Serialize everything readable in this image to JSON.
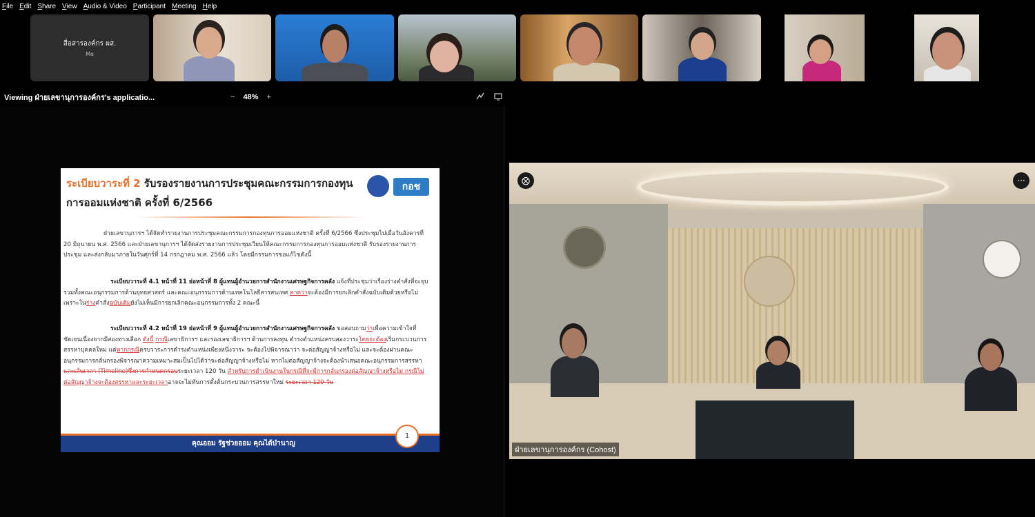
{
  "menu": [
    "File",
    "Edit",
    "Share",
    "View",
    "Audio & Video",
    "Participant",
    "Meeting",
    "Help"
  ],
  "participants": {
    "me_name": "สื่อสารองค์กร ผส.",
    "me_tag": "Me"
  },
  "viewbar": {
    "viewing": "Viewing ฝ่ายเลขานุการองค์กร's applicatio...",
    "zoom_minus": "−",
    "zoom_level": "48%",
    "zoom_plus": "+"
  },
  "slide": {
    "title_highlight": "ระเบียบวาระที่ 2",
    "title_rest": " รับรองรายงานการประชุมคณะกรรมการกองทุน",
    "title_line2": "การออมแห่งชาติ ครั้งที่ 6/2566",
    "logo": "กอช",
    "p1": "ฝ่ายเลขานุการฯ ได้จัดทำรายงานการประชุมคณะกรรมการกองทุนการออมแห่งชาติ ครั้งที่ 6/2566 ซึ่งประชุมไปเมื่อวันอังคารที่ 20 มิถุนายน พ.ศ. 2566 และฝ่ายเลขานุการฯ ได้จัดส่งรายงานการประชุมเวียนให้คณะกรรมการกองทุนการออมแห่งชาติ รับรองรายงานการประชุม และส่งกลับมาภายในวันศุกร์ที่ 14 กรกฎาคม พ.ศ. 2566 แล้ว โดยมีกรรมการขอแก้ไขดังนี้",
    "p2_bold": "ระเบียบวาระที่ 4.1 หน้าที่ 11 ย่อหน้าที่ 8  ผู้แทนผู้อำนวยการสำนักงานเศรษฐกิจการคลัง",
    "p2_a": " แจ้งที่ประชุมว่าเรื่องร่างคำสั่งที่จะยุบรวมทั้งคณะอนุกรรมการด้านยุทธศาสตร์ และคณะอนุกรรมการด้านเทคโนโลยีสารสนเทศ ",
    "p2_red1": "คาดว่า",
    "p2_b": "จะต้องมีการยกเลิกคำสั่งฉบับเดิมด้วยหรือไม่ เพราะใน",
    "p2_red2": "ร่าง",
    "p2_c": "คำสั่ง",
    "p2_red3": "ฉบับเดิม",
    "p2_d": "ยังไม่เห็นมีการยกเลิกคณะอนุกรรมการทั้ง 2 คณะนี้",
    "p3_bold": "ระเบียบวาระที่ 4.2 หน้าที่ 19 ย่อหน้าที่ 9  ผู้แทนผู้อำนวยการสำนักงานเศรษฐกิจการคลัง",
    "p3_a": " ขอสอบถาม",
    "p3_red1": "ว่า",
    "p3_b": "เพื่อความเข้าใจที่ชัดเจนเนื่องจากมีสองทางเลือก ",
    "p3_red2": "ดังนี้",
    "p3_c": " ",
    "p3_red3": "กรณี",
    "p3_d": "เลขาธิการฯ และรองเลขาธิการฯ ด้านการลงทุน ดำรงตำแหน่งครบสองวาระ",
    "p3_red4": "โดยจะต้อง",
    "p3_e": "เริ่มกระบวนการสรรหาบุคคลใหม่ แต่",
    "p3_red5": "หากกรณี",
    "p3_f": "ครบวาระการดำรงตำแหน่งเพียงหนึ่งวาระ จะต้องไปพิจารณาว่า จะต่อสัญญาจ้างหรือไม่ และจะต้องผ่านคณะอนุกรรมการกลั่นกรองพิจารณาความเหมาะสมเป็นไปได้ว่าจะต่อสัญญาจ้างหรือไม่ หากไม่ต่อสัญญาจ้างจะต้องนำเสนอคณะอนุกรรมการสรรหา ",
    "p3_strike1": "และเส้นเวลา (Timeline)ซึ่งการกำหนดกรอบ",
    "p3_g": "ระยะเวลา 120 วัน ",
    "p3_red6": "สำหรับการดำเนินงานในกรณีที่จะมีการกลั่นกรองต่อสัญญาจ้างหรือไม่ กรณีไม่ต่อสัญญาจ้างจะต้องสรรหาและระยะเวลา",
    "p3_h": "อาจจะไม่ทันการตั้งต้นกระบวนการสรรหาใหม่ ",
    "p3_strike2": "ระยะเวลา 120 วัน",
    "footer": "คุณออม รัฐช่วยออม คุณได้บำนาญ",
    "page_number": "1"
  },
  "main_video": {
    "name": "ฝ่ายเลขานุการองค์กร (Cohost)",
    "pin_icon_glyph": "⨂",
    "more_glyph": "···"
  }
}
